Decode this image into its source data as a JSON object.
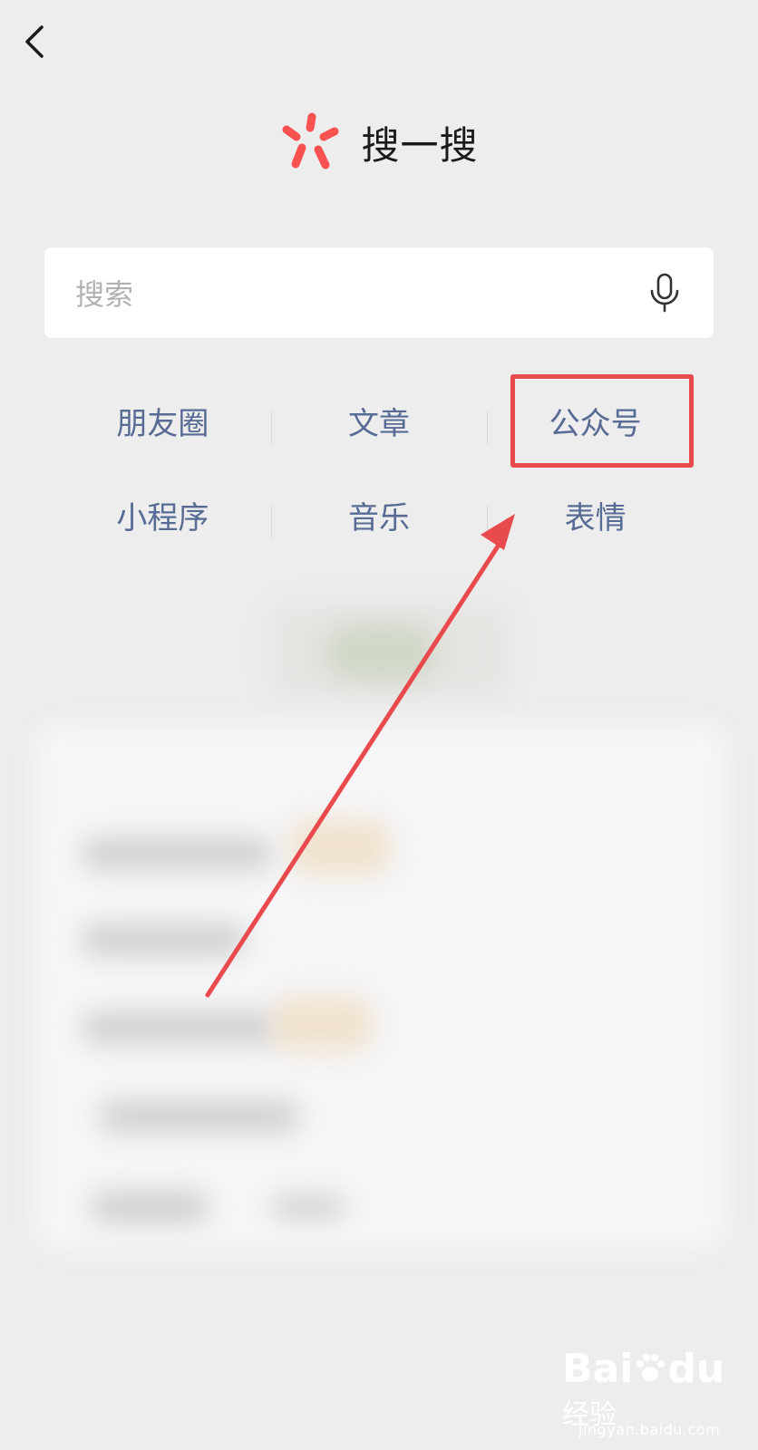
{
  "header": {
    "title": "搜一搜"
  },
  "search": {
    "placeholder": "搜索"
  },
  "categories": {
    "row1": [
      "朋友圈",
      "文章",
      "公众号"
    ],
    "row2": [
      "小程序",
      "音乐",
      "表情"
    ]
  },
  "colors": {
    "background": "#ededed",
    "category_text": "#576b95",
    "logo_red": "#fa5151",
    "annotation_red": "#e84a4d"
  },
  "icons": {
    "back": "chevron-left-icon",
    "logo": "sou-yi-sou-logo-icon",
    "voice": "microphone-icon"
  },
  "watermark": {
    "brand": "Bai",
    "brand2": "du",
    "cn": "经验",
    "url": "jingyan.baidu.com"
  }
}
